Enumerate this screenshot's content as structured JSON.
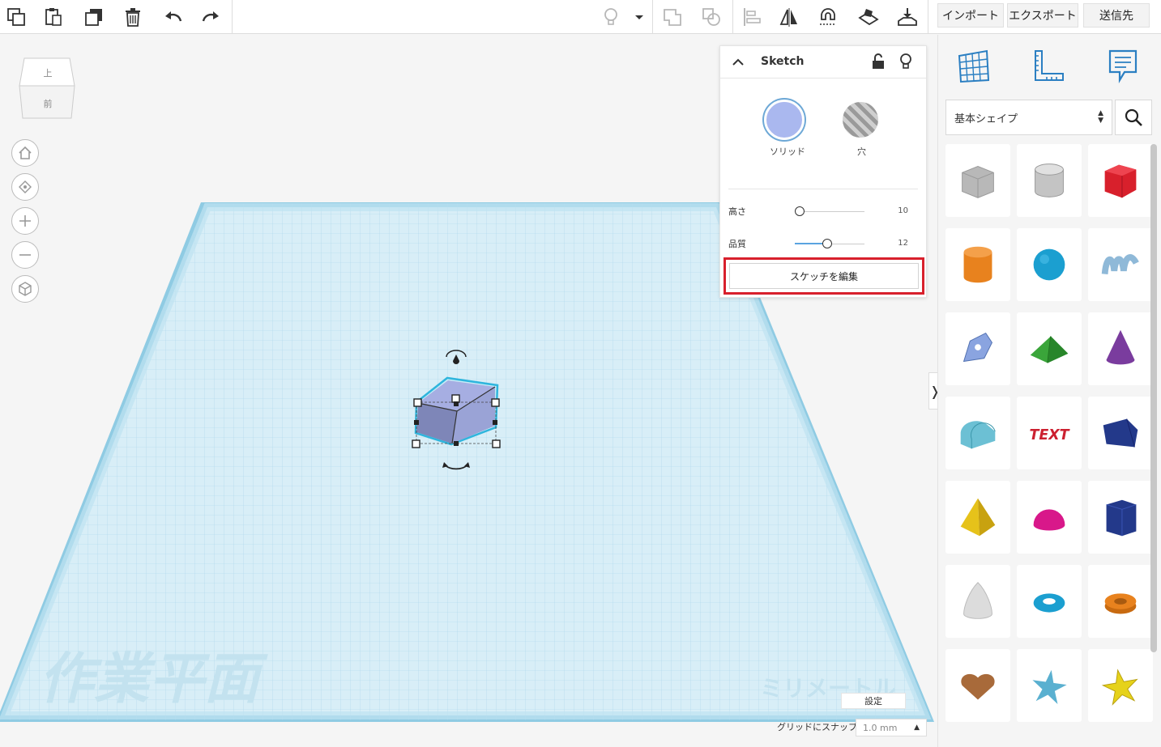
{
  "toolbar": {
    "icons": [
      "copy-icon",
      "paste-icon",
      "duplicate-icon",
      "trash-icon",
      "undo-icon",
      "redo-icon",
      "lightbulb-icon",
      "dropdown-icon",
      "group-icon",
      "ungroup-icon",
      "align-icon",
      "mirror-icon",
      "magnet-icon",
      "workplane-icon",
      "drop-to-workplane-icon"
    ],
    "import_label": "インポート",
    "export_label": "エクスポート",
    "send_label": "送信先"
  },
  "viewcube": {
    "top_label": "上",
    "front_label": "前"
  },
  "workplane": {
    "watermark_left": "作業平面",
    "watermark_right": "ミリメートル",
    "colors": {
      "grid_bg": "#cfe9f4",
      "grid_line": "#a9d6ea",
      "border": "#8fcbe3",
      "shape_fill": "#9aa3d6"
    }
  },
  "inspector": {
    "title": "Sketch",
    "solid_label": "ソリッド",
    "hole_label": "穴",
    "height_label": "高さ",
    "height_value": "10",
    "height_fraction": 0.0,
    "quality_label": "品質",
    "quality_value": "12",
    "quality_fraction": 0.4,
    "edit_sketch_label": "スケッチを編集",
    "highlight_color": "#d8202c"
  },
  "settings_label": "設定",
  "snap": {
    "label": "グリッドにスナップ",
    "value": "1.0 mm"
  },
  "right_panel": {
    "category": "基本シェイプ",
    "icons": [
      "workplane-grid-icon",
      "ruler-icon",
      "notes-icon",
      "search-icon"
    ],
    "shapes": [
      {
        "name": "box-hole",
        "color": "#b8b8b8"
      },
      {
        "name": "cylinder-hole",
        "color": "#c4c4c4"
      },
      {
        "name": "box",
        "color": "#d8202c"
      },
      {
        "name": "cylinder",
        "color": "#e8821e"
      },
      {
        "name": "sphere",
        "color": "#1b9fd0"
      },
      {
        "name": "scribble",
        "color": "#8fb9d8"
      },
      {
        "name": "sketch",
        "color": "#8aa4e0"
      },
      {
        "name": "roof",
        "color": "#3aa53a"
      },
      {
        "name": "cone",
        "color": "#7a3c9e"
      },
      {
        "name": "round-roof",
        "color": "#6cc0d4"
      },
      {
        "name": "text",
        "color": "#cc2030"
      },
      {
        "name": "wedge",
        "color": "#23398a"
      },
      {
        "name": "pyramid",
        "color": "#e6c21a"
      },
      {
        "name": "half-sphere",
        "color": "#d8188a"
      },
      {
        "name": "polygon",
        "color": "#23398a"
      },
      {
        "name": "paraboloid",
        "color": "#dcdcdc"
      },
      {
        "name": "torus",
        "color": "#1b9fd0"
      },
      {
        "name": "tube",
        "color": "#e8821e"
      },
      {
        "name": "heart",
        "color": "#a86a3a"
      },
      {
        "name": "star",
        "color": "#5ab0d0"
      },
      {
        "name": "star-yellow",
        "color": "#e6d21a"
      }
    ]
  }
}
